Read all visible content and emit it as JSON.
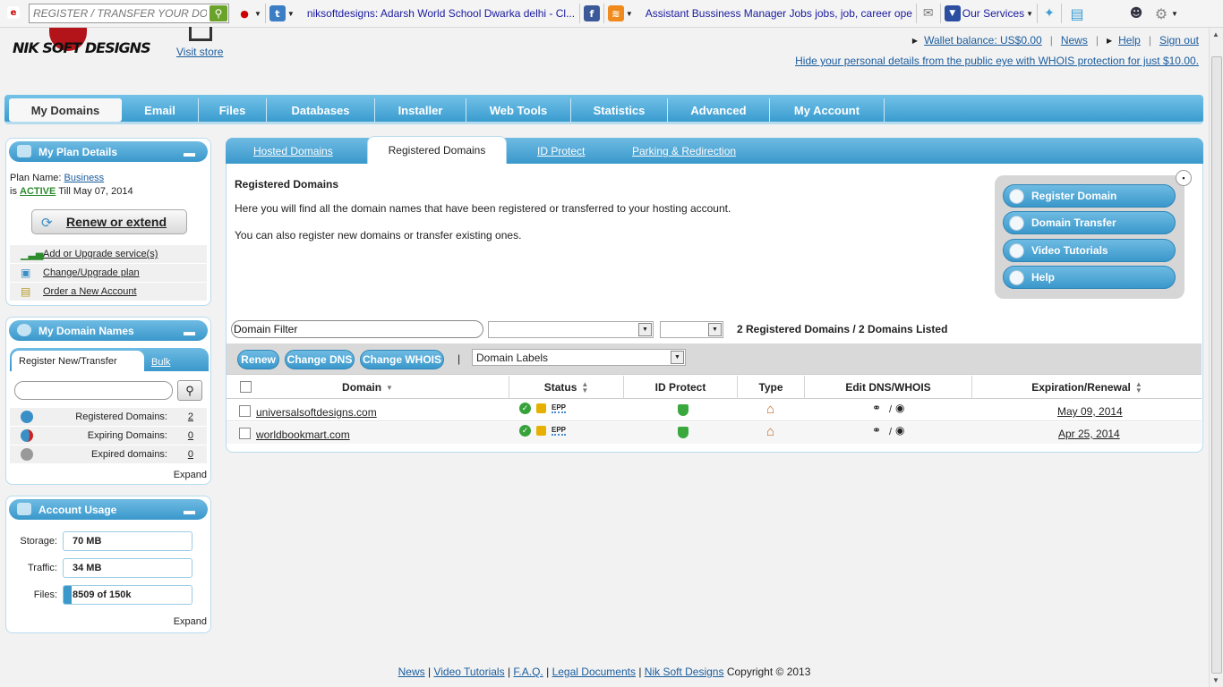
{
  "browser_toolbar": {
    "search_placeholder": "REGISTER / TRANSFER YOUR DOMAIN",
    "tab1_text": "niksoftdesigns: Adarsh World School Dwarka delhi - Cl...",
    "tab2_text": "Assistant Bussiness Manager Jobs jobs, job, career ope...",
    "services_label": "Our Services"
  },
  "header": {
    "logo_text": "NIK SOFT DESIGNS",
    "visit_store": "Visit store",
    "wallet": "Wallet balance: US$0.00",
    "news": "News",
    "help": "Help",
    "sign_out": "Sign out",
    "whois_promo": "Hide your personal details from the public eye with WHOIS protection for just $10.00."
  },
  "nav": {
    "tabs": [
      "My Domains",
      "Email",
      "Files",
      "Databases",
      "Installer",
      "Web Tools",
      "Statistics",
      "Advanced",
      "My Account"
    ]
  },
  "plan": {
    "title": "My Plan Details",
    "name_label": "Plan Name:",
    "name": "Business",
    "is": "is",
    "status": "ACTIVE",
    "till": "Till May 07, 2014",
    "renew": "Renew or extend",
    "links": [
      "Add or Upgrade service(s)",
      "Change/Upgrade plan",
      "Order a New Account"
    ]
  },
  "domain_names": {
    "title": "My Domain Names",
    "tab_register": "Register New/Transfer",
    "tab_bulk": "Bulk",
    "stats": [
      {
        "label": "Registered Domains:",
        "value": "2"
      },
      {
        "label": "Expiring Domains:",
        "value": "0"
      },
      {
        "label": "Expired domains:",
        "value": "0"
      }
    ],
    "expand": "Expand"
  },
  "usage": {
    "title": "Account Usage",
    "rows": [
      {
        "label": "Storage:",
        "value": "70 MB",
        "fill": 0.0
      },
      {
        "label": "Traffic:",
        "value": "34 MB",
        "fill": 0.0
      },
      {
        "label": "Files:",
        "value": "8509 of 150k",
        "fill": 0.057
      }
    ],
    "expand": "Expand"
  },
  "main": {
    "tabs": [
      "Hosted Domains",
      "Registered Domains",
      "ID Protect",
      "Parking & Redirection"
    ],
    "heading": "Registered Domains",
    "desc1": "Here you will find all the domain names that have been registered or transferred to your hosting account.",
    "desc2": "You can also register new domains or transfer existing ones.",
    "quick_buttons": [
      "Register Domain",
      "Domain Transfer",
      "Video Tutorials",
      "Help"
    ],
    "filter_value": "Domain Filter",
    "count_text": "2 Registered Domains / 2 Domains Listed",
    "actions": [
      "Renew",
      "Change DNS",
      "Change WHOIS"
    ],
    "pipe": "|",
    "labels_select": "Domain Labels",
    "columns": [
      "Domain",
      "Status",
      "ID Protect",
      "Type",
      "Edit DNS/WHOIS",
      "Expiration/Renewal"
    ],
    "rows": [
      {
        "domain": "universalsoftdesigns.com",
        "expiry": "May 09, 2014"
      },
      {
        "domain": "worldbookmart.com",
        "expiry": "Apr 25, 2014"
      }
    ],
    "epp": "EPP",
    "slash": "/"
  },
  "footer": {
    "links": [
      "News",
      "Video Tutorials",
      "F.A.Q.",
      "Legal Documents",
      "Nik Soft Designs"
    ],
    "sep": "|",
    "copyright": "Copyright © 2013"
  },
  "colors": {
    "accent": "#3a9ccf",
    "active_status": "#2e8b2e",
    "link": "#1a5c9e"
  }
}
